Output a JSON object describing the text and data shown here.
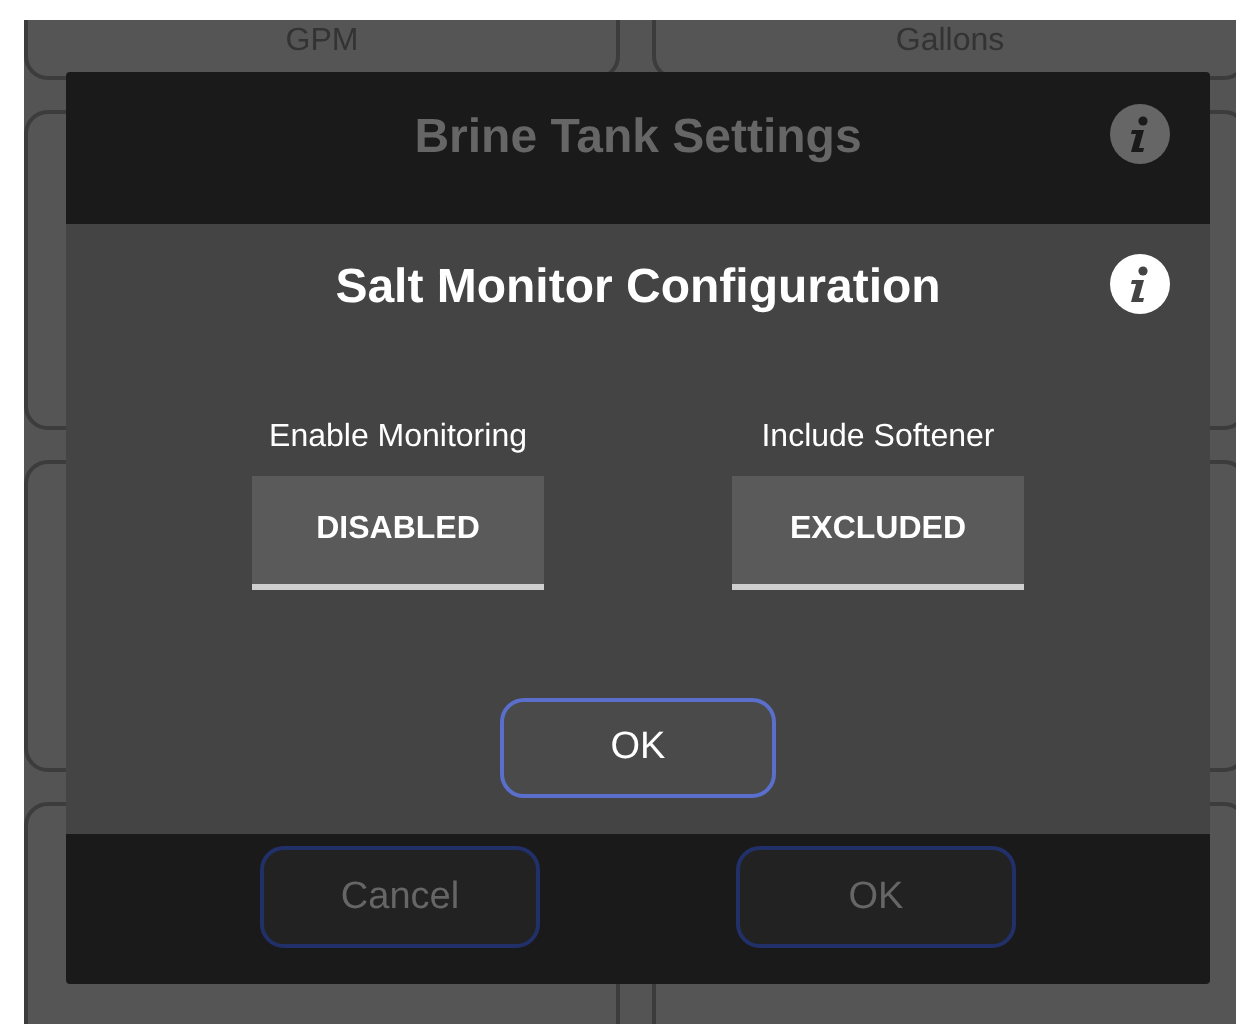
{
  "background": {
    "top_labels": [
      "GPM",
      "Gallons"
    ]
  },
  "brine_dialog": {
    "title": "Brine Tank Settings",
    "buttons": [
      "Cancel",
      "OK"
    ]
  },
  "salt_dialog": {
    "title": "Salt Monitor Configuration",
    "toggles": [
      {
        "label": "Enable Monitoring",
        "value": "DISABLED",
        "on": false
      },
      {
        "label": "Include Softener",
        "value": "EXCLUDED",
        "on": false
      }
    ],
    "button": "OK"
  }
}
